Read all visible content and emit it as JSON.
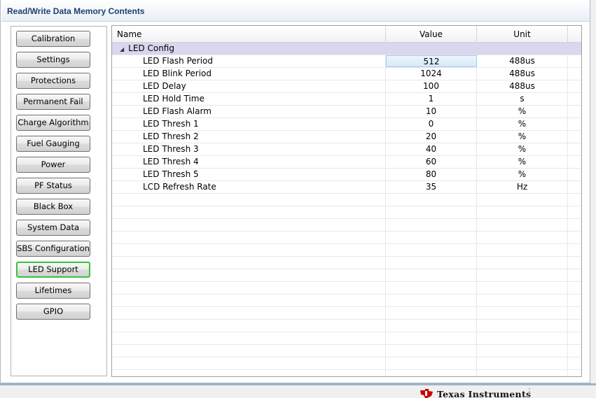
{
  "panel": {
    "title": "Read/Write Data Memory Contents"
  },
  "nav": {
    "buttons": [
      {
        "label": "Calibration"
      },
      {
        "label": "Settings"
      },
      {
        "label": "Protections"
      },
      {
        "label": "Permanent Fail"
      },
      {
        "label": "Charge Algorithm"
      },
      {
        "label": "Fuel Gauging"
      },
      {
        "label": "Power"
      },
      {
        "label": "PF Status"
      },
      {
        "label": "Black Box"
      },
      {
        "label": "System Data"
      },
      {
        "label": "SBS Configuration"
      },
      {
        "label": "LED Support"
      },
      {
        "label": "Lifetimes"
      },
      {
        "label": "GPIO"
      }
    ],
    "active_index": 11
  },
  "grid": {
    "columns": [
      "Name",
      "Value",
      "Unit"
    ],
    "group": {
      "expander": "◢",
      "label": "LED Config"
    },
    "rows": [
      {
        "name": "LED Flash Period",
        "value": "512",
        "unit": "488us"
      },
      {
        "name": "LED Blink Period",
        "value": "1024",
        "unit": "488us"
      },
      {
        "name": "LED Delay",
        "value": "100",
        "unit": "488us"
      },
      {
        "name": "LED Hold Time",
        "value": "1",
        "unit": "s"
      },
      {
        "name": "LED Flash Alarm",
        "value": "10",
        "unit": "%"
      },
      {
        "name": "LED Thresh 1",
        "value": "0",
        "unit": "%"
      },
      {
        "name": "LED Thresh 2",
        "value": "20",
        "unit": "%"
      },
      {
        "name": "LED Thresh 3",
        "value": "40",
        "unit": "%"
      },
      {
        "name": "LED Thresh 4",
        "value": "60",
        "unit": "%"
      },
      {
        "name": "LED Thresh 5",
        "value": "80",
        "unit": "%"
      },
      {
        "name": "LCD Refresh Rate",
        "value": "35",
        "unit": "Hz"
      }
    ],
    "selected_row": 0
  },
  "footer": {
    "brand": "Texas Instruments",
    "brand_icon": "ti-logo-icon"
  },
  "colors": {
    "title_text": "#1d3f6e",
    "group_row": "#d9d6ee",
    "active_border": "#38c23a",
    "selection": "#d6e8fb"
  }
}
